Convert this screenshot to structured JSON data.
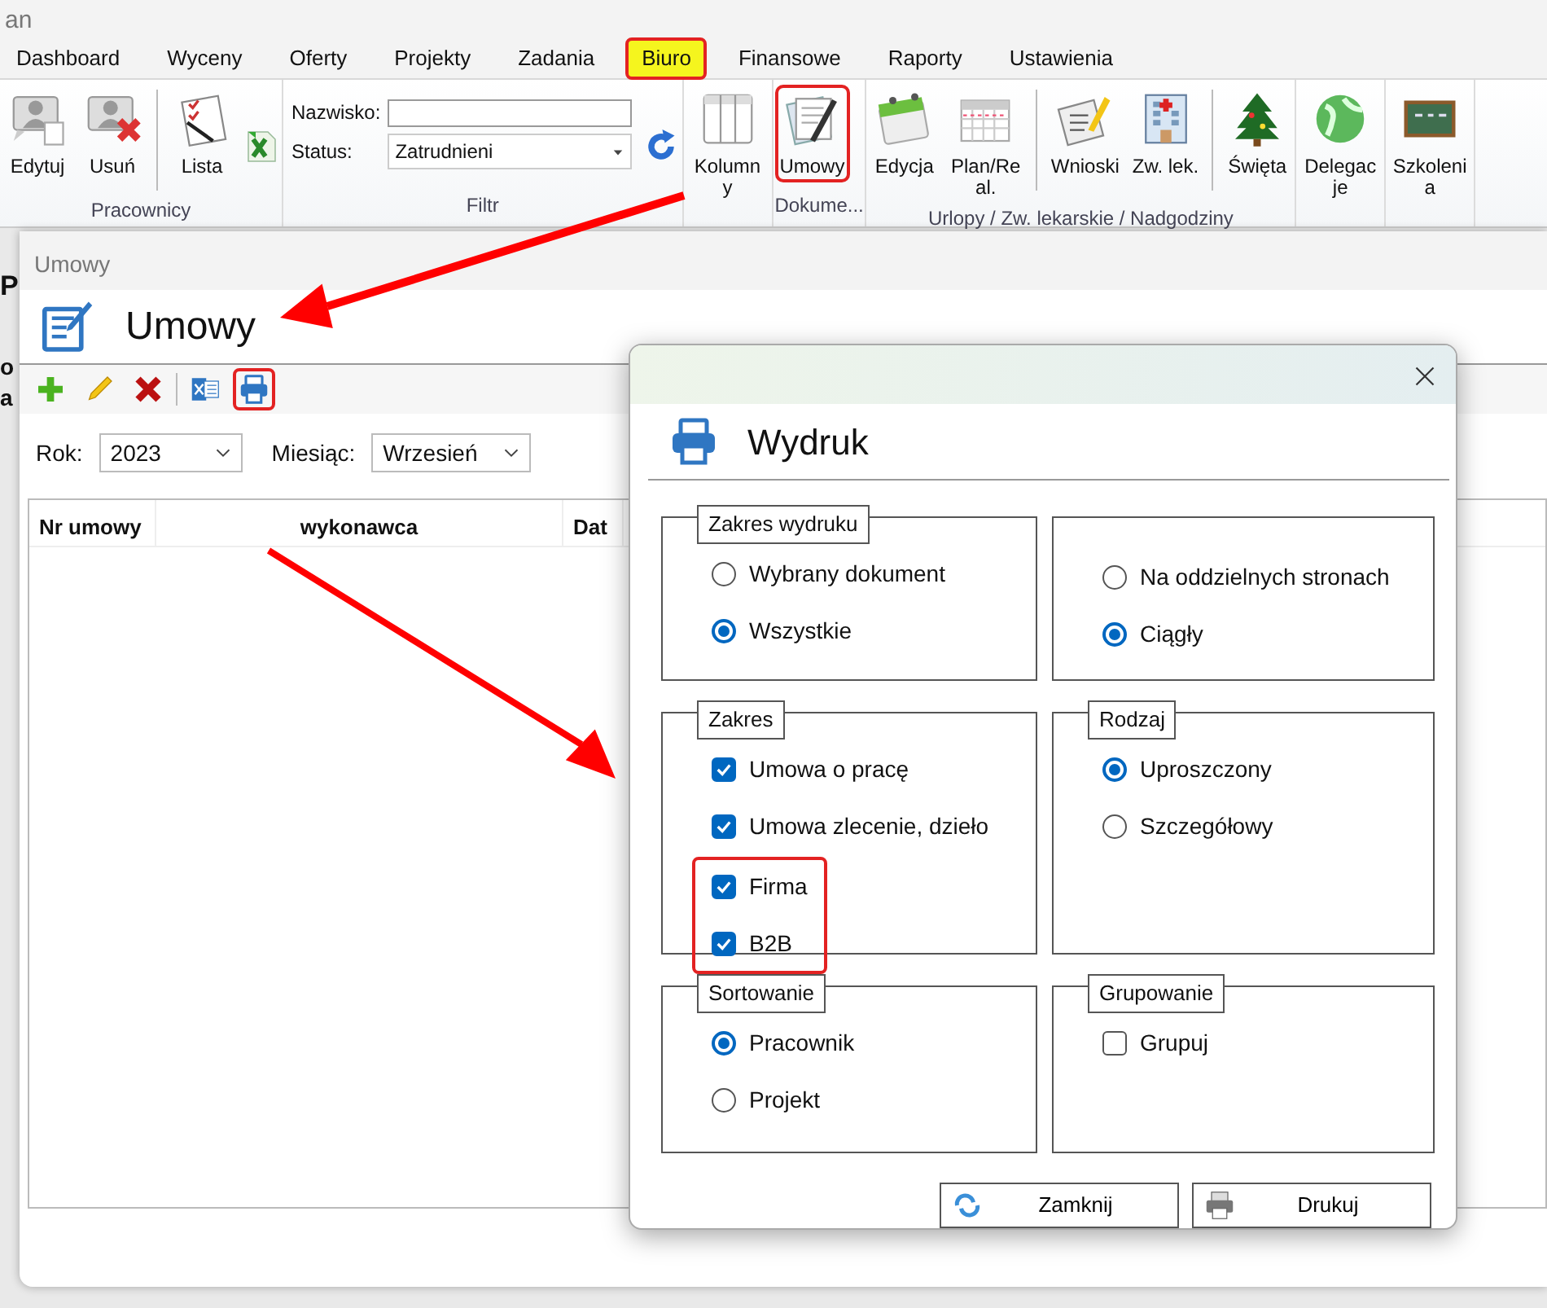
{
  "app": {
    "title": "an",
    "menu": [
      {
        "label": "Dashboard",
        "selected": false
      },
      {
        "label": "Wyceny",
        "selected": false
      },
      {
        "label": "Oferty",
        "selected": false
      },
      {
        "label": "Projekty",
        "selected": false
      },
      {
        "label": "Zadania",
        "selected": false
      },
      {
        "label": "Biuro",
        "selected": true
      },
      {
        "label": "Finansowe",
        "selected": false
      },
      {
        "label": "Raporty",
        "selected": false
      },
      {
        "label": "Ustawienia",
        "selected": false
      }
    ],
    "ribbon": [
      {
        "label": "Pracownicy",
        "items": [
          {
            "kind": "button",
            "label": "Edytuj"
          },
          {
            "kind": "button",
            "label": "Usuń"
          },
          {
            "kind": "separator"
          },
          {
            "kind": "button",
            "label": "Lista"
          },
          {
            "kind": "icon"
          }
        ]
      },
      {
        "label": "Filtr",
        "items": [
          {
            "kind": "filter",
            "name_label": "Nazwisko:",
            "status_label": "Status:",
            "status_value": "Zatrudnieni"
          },
          {
            "kind": "icon"
          }
        ]
      },
      {
        "items": [
          {
            "kind": "button",
            "label": "Kolumny"
          }
        ]
      },
      {
        "label": "Dokume...",
        "items": [
          {
            "kind": "button",
            "label": "Umowy",
            "highlighted": true
          }
        ]
      },
      {
        "label": "Urlopy / Zw. lekarskie / Nadgodziny",
        "items": [
          {
            "kind": "button",
            "label": "Edycja"
          },
          {
            "kind": "button",
            "label": "Plan/Real."
          },
          {
            "kind": "separator"
          },
          {
            "kind": "button",
            "label": "Wnioski"
          },
          {
            "kind": "button",
            "label": "Zw. lek."
          },
          {
            "kind": "separator"
          },
          {
            "kind": "button",
            "label": "Święta"
          }
        ]
      },
      {
        "items": [
          {
            "kind": "button",
            "label": "Delegacje"
          }
        ]
      },
      {
        "items": [
          {
            "kind": "button",
            "label": "Szkolenia"
          }
        ]
      }
    ],
    "edge_fragments": [
      "P",
      "o",
      "a"
    ]
  },
  "contracts_window": {
    "title": "Umowy",
    "heading": "Umowy",
    "toolbar": [
      {
        "kind": "tool"
      },
      {
        "kind": "tool"
      },
      {
        "kind": "tool"
      },
      {
        "kind": "separator"
      },
      {
        "kind": "tool"
      },
      {
        "kind": "tool",
        "highlighted": true
      }
    ],
    "filters": [
      {
        "label": "Rok:",
        "value": "2023"
      },
      {
        "label": "Miesiąc:",
        "value": "Wrzesień"
      }
    ],
    "table": {
      "columns": [
        "Nr umowy",
        "wykonawca",
        "Dat"
      ]
    }
  },
  "print_dialog": {
    "title": "Wydruk",
    "groups": [
      {
        "label": "Zakres wydruku",
        "kind": "radio",
        "options": [
          {
            "label": "Wybrany dokument",
            "selected": false
          },
          {
            "label": "Wszystkie",
            "selected": true
          }
        ]
      },
      {
        "kind": "radio",
        "options": [
          {
            "label": "Na oddzielnych stronach",
            "selected": false
          },
          {
            "label": "Ciągły",
            "selected": true
          }
        ]
      },
      {
        "label": "Zakres",
        "kind": "checkbox",
        "options": [
          {
            "label": "Umowa o pracę",
            "checked": true
          },
          {
            "label": "Umowa zlecenie, dzieło",
            "checked": true
          },
          {
            "label": "Firma",
            "checked": true,
            "highlighted": true
          },
          {
            "label": "B2B",
            "checked": true,
            "highlighted": true
          }
        ]
      },
      {
        "label": "Rodzaj",
        "kind": "radio",
        "options": [
          {
            "label": "Uproszczony",
            "selected": true
          },
          {
            "label": "Szczegółowy",
            "selected": false
          }
        ]
      },
      {
        "label": "Sortowanie",
        "kind": "radio",
        "options": [
          {
            "label": "Pracownik",
            "selected": true
          },
          {
            "label": "Projekt",
            "selected": false
          }
        ]
      },
      {
        "label": "Grupowanie",
        "kind": "checkbox",
        "options": [
          {
            "label": "Grupuj",
            "checked": false
          }
        ]
      }
    ],
    "buttons": [
      "Zamknij",
      "Drukuj"
    ]
  }
}
